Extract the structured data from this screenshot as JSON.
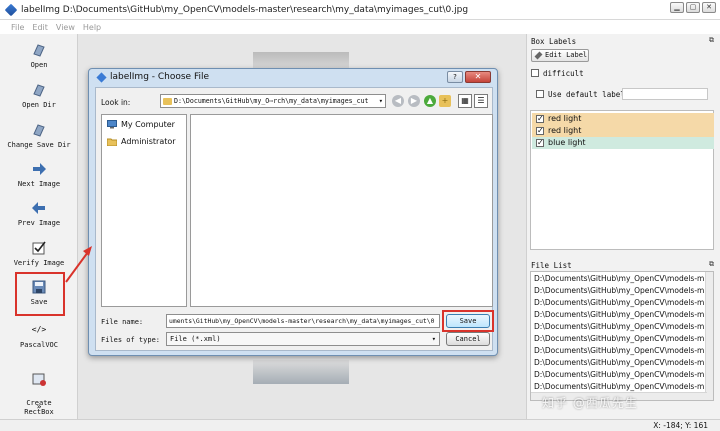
{
  "window": {
    "title": "labelImg D:\\Documents\\GitHub\\my_OpenCV\\models-master\\research\\my_data\\myimages_cut\\0.jpg",
    "buttons": [
      "▁",
      "▢",
      "✕"
    ]
  },
  "menu": [
    "File",
    "Edit",
    "View",
    "Help"
  ],
  "toolbar": {
    "open": "Open",
    "open_dir": "Open Dir",
    "change_save_dir": "Change Save Dir",
    "next_image": "Next Image",
    "prev_image": "Prev Image",
    "verify_image": "Verify Image",
    "save": "Save",
    "format_icon": "</>",
    "format": "PascalVOC",
    "create_rectbox": "Create\nRectBox",
    "more": "»"
  },
  "box_labels": {
    "header": "Box Labels",
    "edit_label": "Edit Label",
    "difficult": "difficult",
    "use_default_label": "Use default label",
    "default_label_value": "",
    "items": [
      {
        "label": "red light",
        "checked": true,
        "color": "#f5d9a8"
      },
      {
        "label": "red light",
        "checked": true,
        "color": "#f5d9a8"
      },
      {
        "label": "blue light",
        "checked": true,
        "color": "#cfeadf"
      }
    ]
  },
  "file_list": {
    "header": "File List",
    "items": [
      "D:\\Documents\\GitHub\\my_OpenCV\\models-m",
      "D:\\Documents\\GitHub\\my_OpenCV\\models-m",
      "D:\\Documents\\GitHub\\my_OpenCV\\models-m",
      "D:\\Documents\\GitHub\\my_OpenCV\\models-m",
      "D:\\Documents\\GitHub\\my_OpenCV\\models-m",
      "D:\\Documents\\GitHub\\my_OpenCV\\models-m",
      "D:\\Documents\\GitHub\\my_OpenCV\\models-m",
      "D:\\Documents\\GitHub\\my_OpenCV\\models-m",
      "D:\\Documents\\GitHub\\my_OpenCV\\models-m",
      "D:\\Documents\\GitHub\\my_OpenCV\\models-m"
    ]
  },
  "status": {
    "coords": "X: -184; Y: 161"
  },
  "dialog": {
    "title": "labelImg - Choose File",
    "help": "?",
    "close": "✕",
    "look_in_label": "Look in:",
    "look_in_value": "D:\\Documents\\GitHub\\my_O⋯rch\\my_data\\myimages_cut",
    "places": [
      "My Computer",
      "Administrator"
    ],
    "file_name_label": "File name:",
    "file_name_value": "uments\\GitHub\\my_OpenCV\\models-master\\research\\my_data\\myimages_cut\\0",
    "file_type_label": "Files of type:",
    "file_type_value": "File (*.xml)",
    "save": "Save",
    "cancel": "Cancel"
  },
  "watermark": "知乎 @西瓜先生"
}
